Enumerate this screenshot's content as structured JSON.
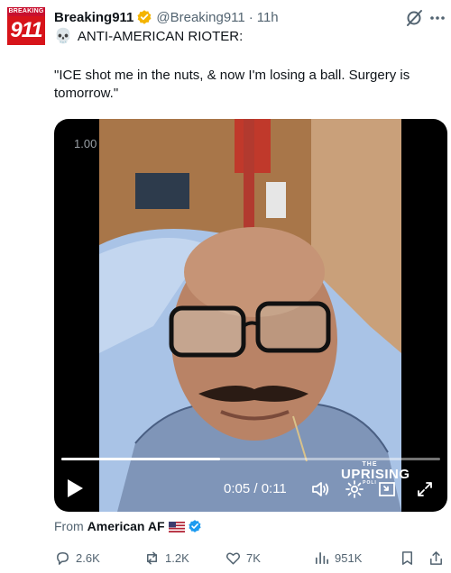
{
  "author": {
    "avatar_top": "BREAKING",
    "avatar_num": "911",
    "name": "Breaking911",
    "handle": "@Breaking911",
    "separator": "·",
    "time": "11h"
  },
  "tweet": {
    "line1": "ANTI-AMERICAN RIOTER:",
    "quote": "\"ICE shot me in the nuts, & now I'm losing a ball. Surgery is tomorrow.\""
  },
  "video": {
    "pip_label": "1.00",
    "time": "0:05 / 0:11",
    "progress": 0.42,
    "watermark": {
      "small": "THE",
      "big": "UPRISING",
      "sub": "POLI"
    }
  },
  "from": {
    "prefix": "From",
    "source": "American AF"
  },
  "actions": {
    "replies": "2.6K",
    "reposts": "1.2K",
    "likes": "7K",
    "views": "951K"
  },
  "colors": {
    "verified_gold": "#f4b400",
    "verified_blue": "#1d9bf0",
    "muted": "#536471"
  }
}
